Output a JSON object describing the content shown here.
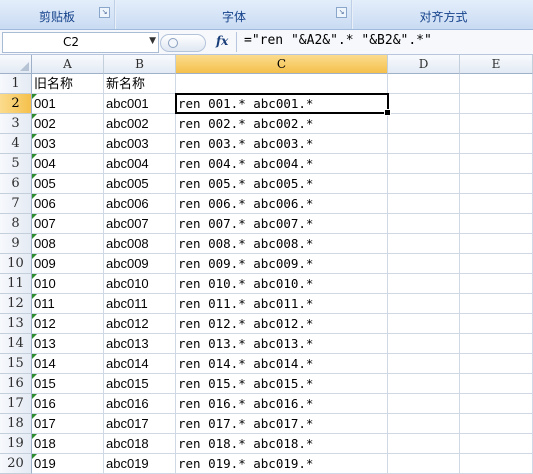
{
  "ribbon": {
    "groups": [
      "剪贴板",
      "字体",
      "对齐方式"
    ]
  },
  "formula_bar": {
    "name_box": "C2",
    "fx_label": "fx",
    "formula": "=\"ren \"&A2&\".* \"&B2&\".*\""
  },
  "columns": [
    "A",
    "B",
    "C",
    "D",
    "E"
  ],
  "active_cell": "C2",
  "rows": [
    {
      "num": "1",
      "a": "旧名称",
      "b": "新名称",
      "c": ""
    },
    {
      "num": "2",
      "a": "001",
      "b": "abc001",
      "c": "ren 001.* abc001.*"
    },
    {
      "num": "3",
      "a": "002",
      "b": "abc002",
      "c": "ren 002.* abc002.*"
    },
    {
      "num": "4",
      "a": "003",
      "b": "abc003",
      "c": "ren 003.* abc003.*"
    },
    {
      "num": "5",
      "a": "004",
      "b": "abc004",
      "c": "ren 004.* abc004.*"
    },
    {
      "num": "6",
      "a": "005",
      "b": "abc005",
      "c": "ren 005.* abc005.*"
    },
    {
      "num": "7",
      "a": "006",
      "b": "abc006",
      "c": "ren 006.* abc006.*"
    },
    {
      "num": "8",
      "a": "007",
      "b": "abc007",
      "c": "ren 007.* abc007.*"
    },
    {
      "num": "9",
      "a": "008",
      "b": "abc008",
      "c": "ren 008.* abc008.*"
    },
    {
      "num": "10",
      "a": "009",
      "b": "abc009",
      "c": "ren 009.* abc009.*"
    },
    {
      "num": "11",
      "a": "010",
      "b": "abc010",
      "c": "ren 010.* abc010.*"
    },
    {
      "num": "12",
      "a": "011",
      "b": "abc011",
      "c": "ren 011.* abc011.*"
    },
    {
      "num": "13",
      "a": "012",
      "b": "abc012",
      "c": "ren 012.* abc012.*"
    },
    {
      "num": "14",
      "a": "013",
      "b": "abc013",
      "c": "ren 013.* abc013.*"
    },
    {
      "num": "15",
      "a": "014",
      "b": "abc014",
      "c": "ren 014.* abc014.*"
    },
    {
      "num": "16",
      "a": "015",
      "b": "abc015",
      "c": "ren 015.* abc015.*"
    },
    {
      "num": "17",
      "a": "016",
      "b": "abc016",
      "c": "ren 016.* abc016.*"
    },
    {
      "num": "18",
      "a": "017",
      "b": "abc017",
      "c": "ren 017.* abc017.*"
    },
    {
      "num": "19",
      "a": "018",
      "b": "abc018",
      "c": "ren 018.* abc018.*"
    },
    {
      "num": "20",
      "a": "019",
      "b": "abc019",
      "c": "ren 019.* abc019.*"
    }
  ]
}
